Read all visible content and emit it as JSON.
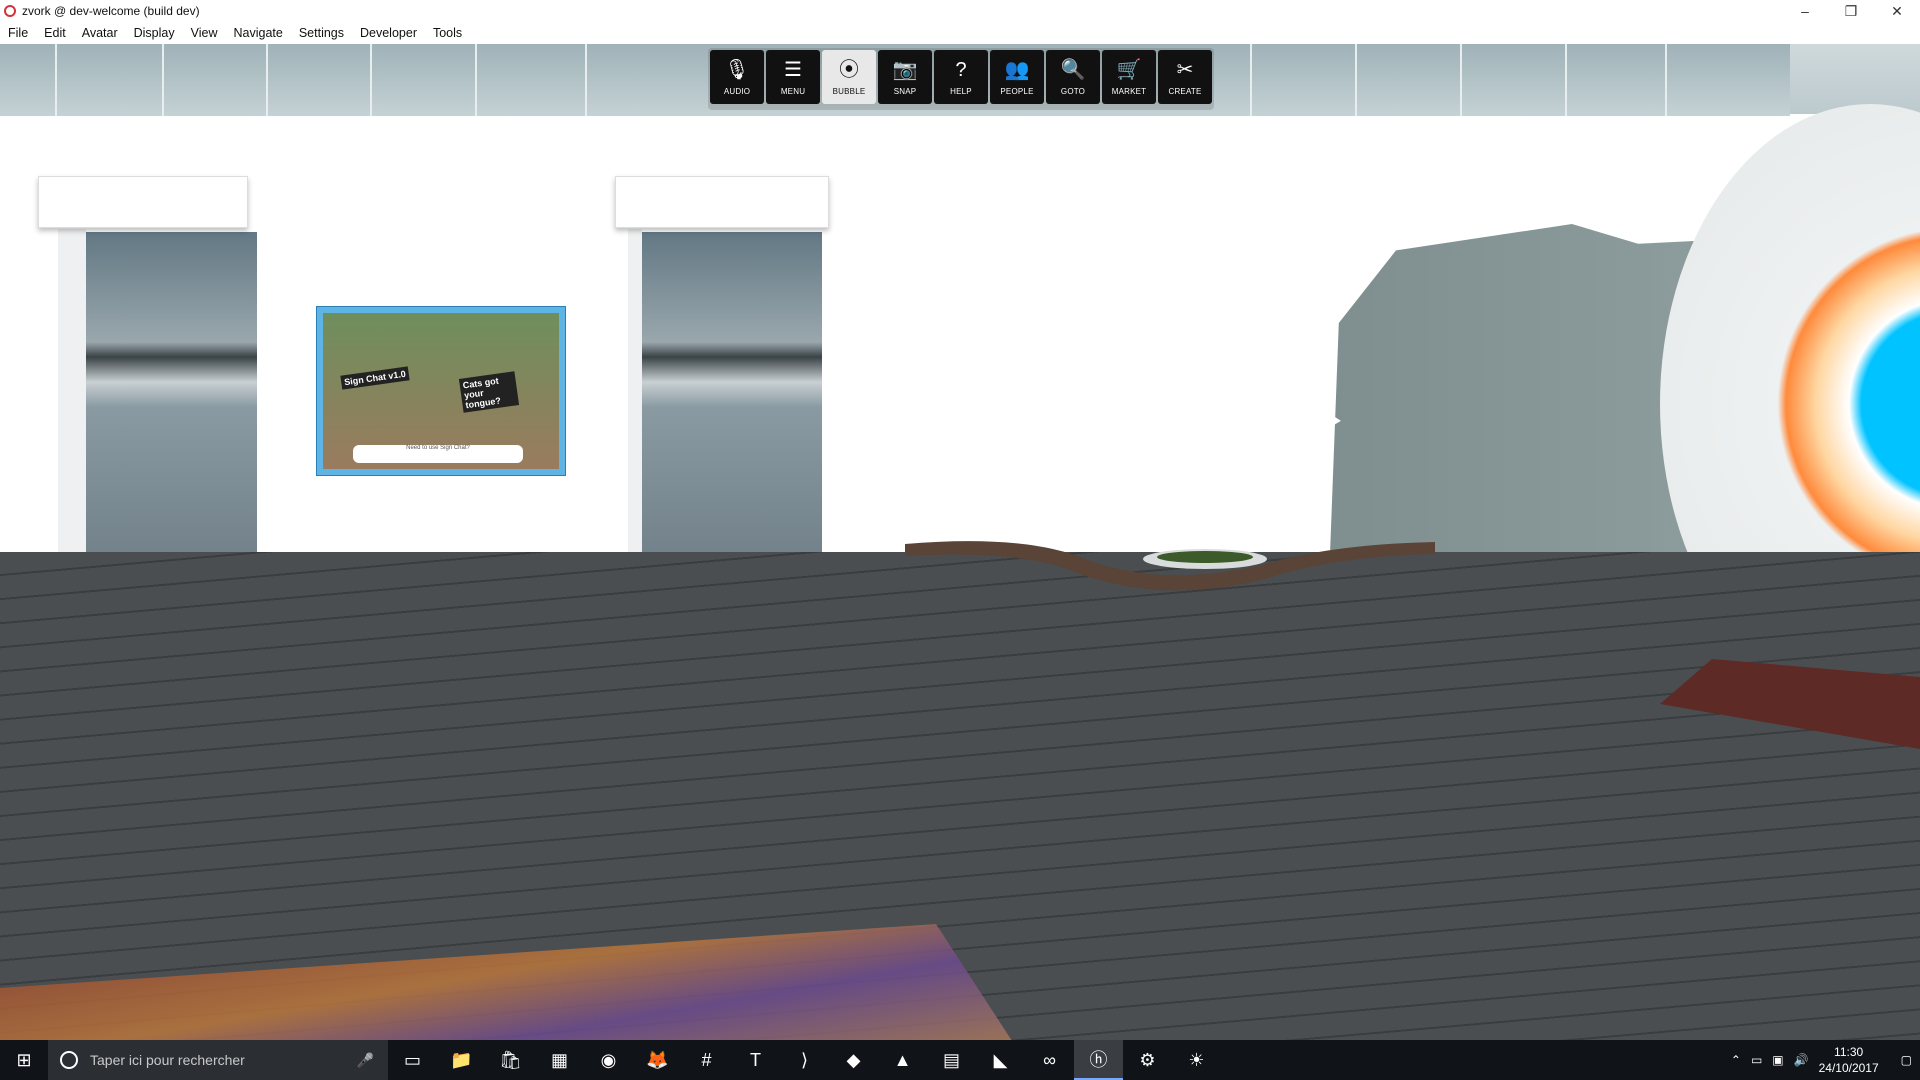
{
  "window": {
    "title": "zvork @ dev-welcome (build dev)",
    "controls": {
      "minimize": "–",
      "restore": "❐",
      "close": "✕"
    }
  },
  "menu": [
    "File",
    "Edit",
    "Avatar",
    "Display",
    "View",
    "Navigate",
    "Settings",
    "Developer",
    "Tools"
  ],
  "toolbar": [
    {
      "label": "AUDIO",
      "icon": "🎙",
      "active": false
    },
    {
      "label": "MENU",
      "icon": "☰",
      "active": false
    },
    {
      "label": "BUBBLE",
      "icon": "⦿",
      "active": true
    },
    {
      "label": "SNAP",
      "icon": "📷",
      "active": false
    },
    {
      "label": "HELP",
      "icon": "?",
      "active": false
    },
    {
      "label": "PEOPLE",
      "icon": "👥",
      "active": false
    },
    {
      "label": "GOTO",
      "icon": "🔍",
      "active": false
    },
    {
      "label": "MARKET",
      "icon": "🛒",
      "active": false
    },
    {
      "label": "CREATE",
      "icon": "✂",
      "active": false
    }
  ],
  "poster": {
    "left_caption": "Sign Chat v1.0",
    "right_caption": "Cats got your tongue?",
    "bar_text": "Need to use Sign Chat?"
  },
  "taskbar": {
    "search_placeholder": "Taper ici pour rechercher",
    "apps": [
      {
        "name": "task-view-icon",
        "glyph": "▭"
      },
      {
        "name": "file-explorer-icon",
        "glyph": "📁"
      },
      {
        "name": "store-icon",
        "glyph": "🛍"
      },
      {
        "name": "calculator-icon",
        "glyph": "▦"
      },
      {
        "name": "browser-icon",
        "glyph": "◉"
      },
      {
        "name": "firefox-icon",
        "glyph": "🦊"
      },
      {
        "name": "slack-icon",
        "glyph": "#"
      },
      {
        "name": "app-icon",
        "glyph": "T"
      },
      {
        "name": "vscode-icon",
        "glyph": "⟩"
      },
      {
        "name": "git-icon",
        "glyph": "◆"
      },
      {
        "name": "paint-icon",
        "glyph": "▲"
      },
      {
        "name": "sheets-icon",
        "glyph": "▤"
      },
      {
        "name": "matlab-icon",
        "glyph": "◣"
      },
      {
        "name": "visual-studio-icon",
        "glyph": "∞"
      },
      {
        "name": "interface-icon",
        "glyph": "ⓗ"
      },
      {
        "name": "settings-icon",
        "glyph": "⚙"
      },
      {
        "name": "sandbox-icon",
        "glyph": "☀"
      }
    ],
    "active_app": "interface-icon",
    "time": "11:30",
    "date": "24/10/2017"
  },
  "colors": {
    "accent": "#77aaff",
    "toolbar_bg": "#111111",
    "taskbar_bg": "#101317"
  }
}
